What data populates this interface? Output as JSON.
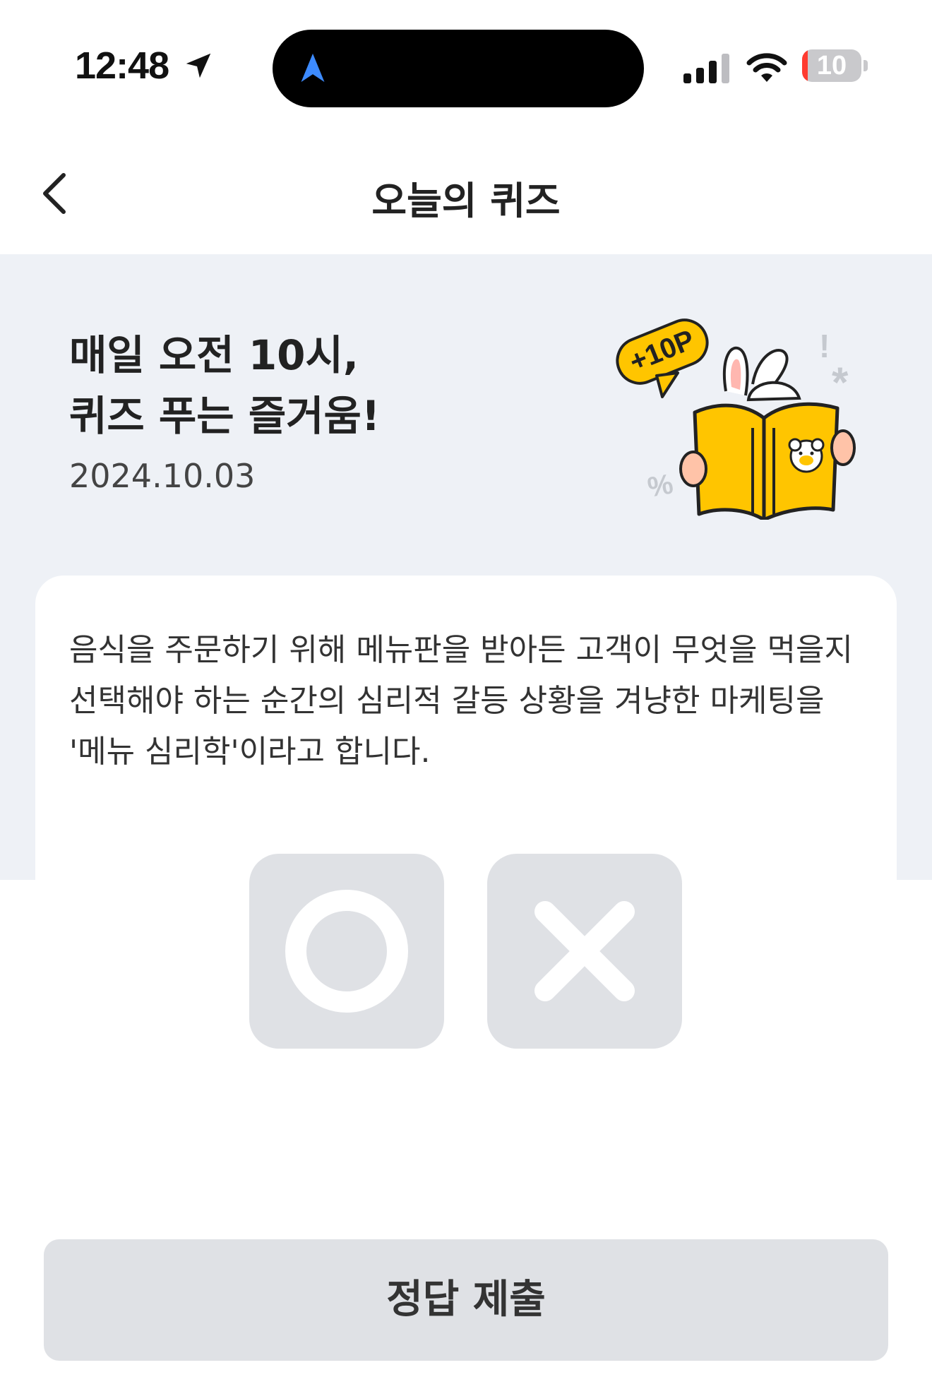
{
  "status_bar": {
    "time": "12:48",
    "battery_level": "10",
    "battery_fraction": 0.1,
    "icons": [
      "location-arrow-icon",
      "navigation-arrow-icon",
      "cellular-signal-icon",
      "wifi-icon",
      "battery-icon"
    ]
  },
  "header": {
    "title": "오늘의 퀴즈",
    "back_icon": "chevron-left-icon"
  },
  "hero": {
    "title_line1": "매일 오전 10시,",
    "title_line2": "퀴즈 푸는 즐거움!",
    "date": "2024.10.03",
    "badge_text": "+10P",
    "illustration": "rabbit-reading-book-mascot"
  },
  "quiz": {
    "question": "음식을 주문하기 위해 메뉴판을 받아든 고객이 무엇을 먹을지 선택해야 하는 순간의 심리적 갈등 상황을 겨냥한 마케팅을 '메뉴 심리학'이라고 합니다.",
    "options": [
      {
        "label": "O",
        "icon": "circle-o-icon"
      },
      {
        "label": "X",
        "icon": "x-mark-icon"
      }
    ]
  },
  "submit": {
    "label": "정답 제출"
  },
  "colors": {
    "hero_bg": "#eef1f6",
    "button_bg": "#dfe1e5",
    "accent_yellow": "#ffc500",
    "battery_low": "#ff3b30"
  }
}
